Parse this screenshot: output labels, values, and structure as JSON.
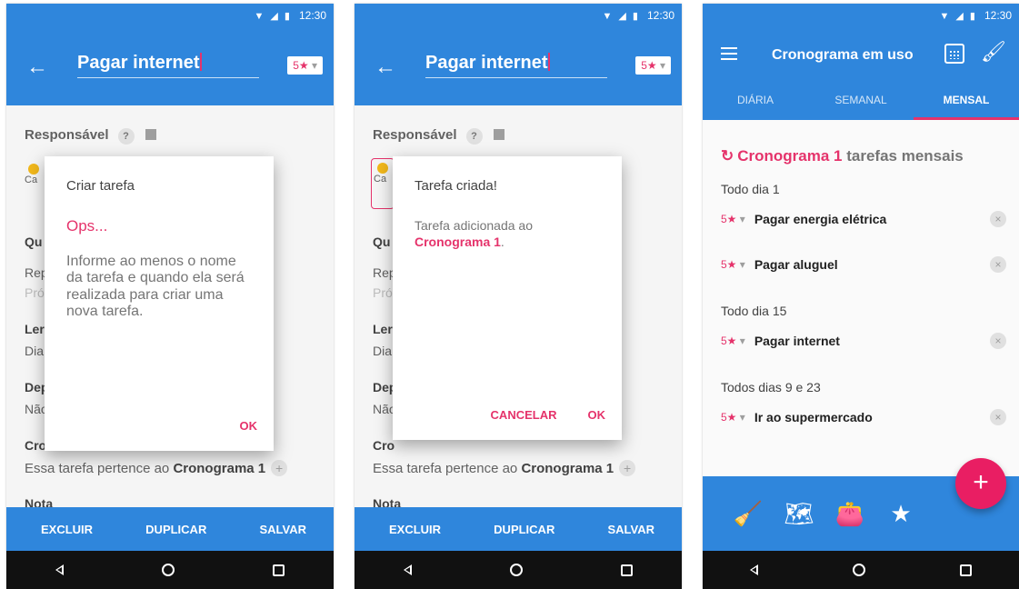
{
  "status": {
    "time": "12:30"
  },
  "task_form": {
    "title_value": "Pagar internet",
    "priority": "5★",
    "priority_caret": "▾",
    "responsavel_label": "Responsável",
    "avatar_label": "Ca",
    "row_qu": "Qu",
    "row_rep": "Rep",
    "row_pro": "Pró",
    "row_len": "Ler",
    "row_dia": "Dia",
    "row_dep": "Dep",
    "row_nao": "Não",
    "cronograma_partial": "Cro",
    "cronograma_text": "Essa tarefa pertence ao",
    "cronograma_name": "Cronograma 1",
    "nota_partial": "Nota",
    "actions": {
      "delete": "EXCLUIR",
      "duplicate": "DUPLICAR",
      "save": "SALVAR"
    }
  },
  "dialog1": {
    "title": "Criar tarefa",
    "subtitle": "Ops...",
    "body": "Informe ao menos o nome da tarefa e quando ela será realizada para criar uma nova tarefa.",
    "ok": "OK"
  },
  "dialog2": {
    "title": "Tarefa criada!",
    "body_prefix": "Tarefa adicionada ao",
    "body_link": "Cronograma 1",
    "body_suffix": ".",
    "cancel": "CANCELAR",
    "ok": "OK"
  },
  "schedule": {
    "title": "Cronograma em uso",
    "tabs": [
      "DIÁRIA",
      "SEMANAL",
      "MENSAL"
    ],
    "heading_name": "Cronograma 1",
    "heading_rest": "tarefas mensais",
    "groups": [
      {
        "label": "Todo dia 1",
        "items": [
          {
            "priority": "5★",
            "text": "Pagar energia elétrica"
          },
          {
            "priority": "5★",
            "text": "Pagar aluguel"
          }
        ]
      },
      {
        "label": "Todo dia 15",
        "items": [
          {
            "priority": "5★",
            "text": "Pagar internet"
          }
        ]
      },
      {
        "label": "Todos dias 9 e 23",
        "items": [
          {
            "priority": "5★",
            "text": "Ir ao supermercado"
          }
        ]
      }
    ],
    "fab": "+",
    "remove_icon": "×"
  },
  "icons": {
    "back": "←",
    "help": "?",
    "add": "+",
    "sync": "↻",
    "star": "★",
    "broom": "🧹",
    "map": "🗺",
    "wallet": "👛",
    "brush": "🖌"
  },
  "colors": {
    "primary": "#2f86dc",
    "accent": "#e5336b",
    "fab": "#e91e63"
  }
}
